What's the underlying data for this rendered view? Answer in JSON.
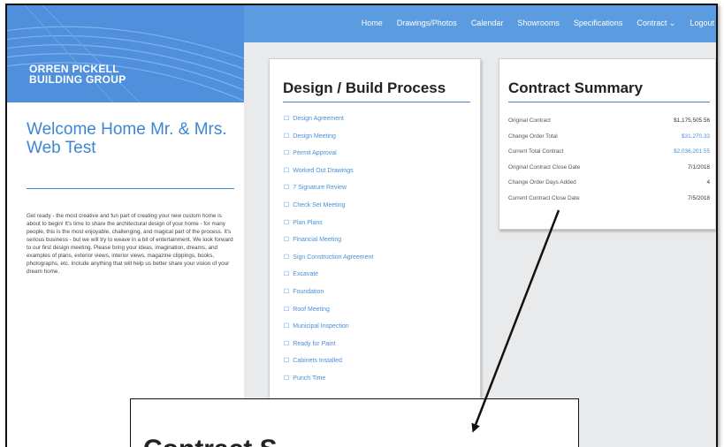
{
  "nav": {
    "items": [
      "Home",
      "Drawings/Photos",
      "Calendar",
      "Showrooms",
      "Specifications",
      "Contract ⌄",
      "Logout"
    ]
  },
  "logo": {
    "line1": "ORREN PICKELL",
    "line2": "BUILDING GROUP"
  },
  "welcome": {
    "heading": "Welcome Home Mr. & Mrs. Web Test",
    "intro": "Get ready - the most creative and fun part of creating your new custom home is about to begin! It's time to share the architectural design of your home - for many people, this is the most enjoyable, challenging, and magical part of the process. It's serious business - but we will try to weave in a bit of entertainment. We look forward to our first design meeting. Please bring your ideas, imagination, dreams, and examples of plans, exterior views, interior views, magazine clippings, books, photographs, etc. Include anything that will help us better share your vision of your dream home."
  },
  "design": {
    "title": "Design / Build Process",
    "steps": [
      "Design Agreement",
      "Design Meeting",
      "Permit Approval",
      "Worked Out Drawings",
      "7 Signature Review",
      "Check Set Meeting",
      "Plan Plans",
      "Financial Meeting",
      "Sign Construction Agreement",
      "Excavate",
      "Foundation",
      "Roof Meeting",
      "Municipal Inspection",
      "Ready for Paint",
      "Cabinets Installed",
      "Punch Time"
    ]
  },
  "summary": {
    "title": "Contract Summary",
    "rows": [
      {
        "label": "Original Contract",
        "value": "$1,175,505.56"
      },
      {
        "label": "Change Order Total",
        "value": "$31,270.33"
      },
      {
        "label": "Current Total Contract",
        "value": "$2,036,201.55"
      },
      {
        "label": "Original Contract Close Date",
        "value": "7/1/2018"
      },
      {
        "label": "Change Order Days Added",
        "value": "4"
      },
      {
        "label": "Current Contract Close Date",
        "value": "7/5/2018"
      }
    ]
  },
  "callout": {
    "title": "Contract S"
  },
  "colors": {
    "accent": "#4f8fdc",
    "link": "#4a8fda",
    "background": "#e9eaec"
  }
}
